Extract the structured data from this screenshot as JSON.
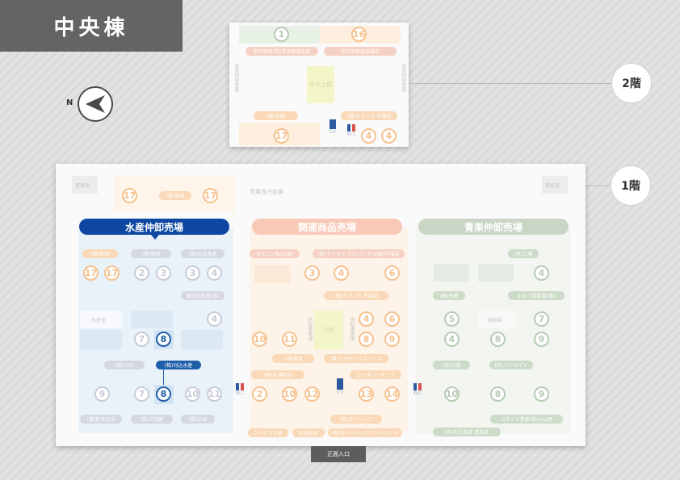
{
  "building_title": "中央棟",
  "compass": {
    "label": "N",
    "icon": "north-arrow-icon"
  },
  "floors": {
    "floor2_label": "2階",
    "floor1_label": "1階"
  },
  "entrance_label": "正面入口",
  "facilities": {
    "ev_label": "EV",
    "wc_label": "W.C"
  },
  "floor2": {
    "top_left_num": "1",
    "top_right_num": "16",
    "bottom_left_num": "17",
    "bottom_right_num_a": "4",
    "bottom_right_num_b": "4",
    "pill_top_left": "荒井商事(株)荒井商事倉庫",
    "pill_top_right": "荒井商事倉庫株式",
    "pill_bottom_left": "(株)太田",
    "pill_bottom_right": "(株)セブンネ 市場店",
    "center_block": "中央上屋",
    "left_vertical": "水産仲卸倉庫",
    "right_vertical": "水産仲卸倉庫"
  },
  "floor1": {
    "top_left_label": "事務室",
    "top_right_label": "事務室",
    "top_center_label": "青果保冷倉庫",
    "top_nums": [
      "17",
      "17"
    ],
    "top_pill": "(株)和田",
    "zones": {
      "seafood": "水産仲卸売場",
      "related": "関連商品売場",
      "produce": "青果仲卸売場"
    },
    "seafood": {
      "pills": [
        "(株)和田",
        "(株)和田",
        "(株)丸吉水産",
        "東日本水産(株)",
        "(株)小川",
        "(株)刈込水産",
        "(株)鈴木北洋",
        "(株)三河屋",
        "(株)三栄"
      ],
      "nums_row1": [
        "17",
        "17",
        "2",
        "3",
        "3",
        "4"
      ],
      "nums_row2": [
        "4"
      ],
      "nums_row3": [
        "7",
        "8"
      ],
      "nums_row4": [
        "9",
        "7",
        "8",
        "10",
        "11"
      ],
      "label_block": "水産室"
    },
    "related": {
      "pills": [
        "マルコン株式(株)",
        "(株)マツモト ツロパッチル(株)市場店",
        "(株)セブンネ 市場店",
        "小野電設",
        "(株)ヒカゲハウスフーズ",
        "(株)丸福物流",
        "ロータリーマーズ",
        "(株)ダイジック",
        "アーデスタ保",
        "有本食品",
        "(株)ヴィーパックフリーウェイ"
      ],
      "nums_row1": [
        "3",
        "4",
        "6"
      ],
      "nums_row2": [
        "4",
        "6"
      ],
      "nums_row3": [
        "10",
        "11",
        "8",
        "9"
      ],
      "nums_row4": [
        "2",
        "10",
        "12",
        "13",
        "14"
      ],
      "center_block": "中庭",
      "left_vertical": "自転車置場",
      "right_vertical": "自転車置場"
    },
    "produce": {
      "pills": [
        "(有)三陽",
        "(株)豆蔵",
        "小山三和青果(株)",
        "(有)三陽",
        "(有)ベジメイト",
        "カネイチ青果(株)小山屋",
        "(有)丸久商店 青果店"
      ],
      "nums_row1": [
        "4"
      ],
      "nums_row2": [
        "5",
        "7"
      ],
      "nums_row3": [
        "4",
        "8",
        "9"
      ],
      "nums_row4": [
        "10",
        "8",
        "9"
      ],
      "label_block": "荷捌場"
    }
  },
  "colors": {
    "title_bg": "#646464",
    "seafood": "#0d47a1",
    "related": "#f9c9b8",
    "produce": "#c9d6c5",
    "highlight": "#1f5ea8",
    "orange_num": "#f6c28f"
  }
}
